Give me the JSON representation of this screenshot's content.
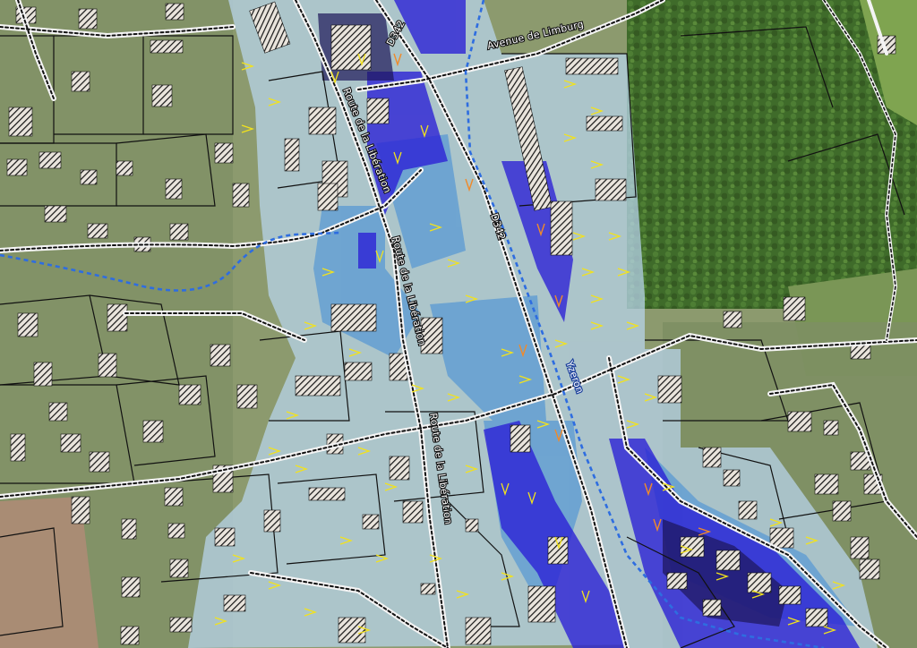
{
  "map": {
    "labels": {
      "avenue_limburg": "Avenue de Limburg",
      "d342_north": "D342",
      "d342_central": "D342",
      "route_liberation_1": "Route de la Libération",
      "route_liberation_2": "Route de la Libération",
      "route_liberation_3": "Route de la Libération",
      "yzeron": "Yzeron"
    },
    "legend_colors": {
      "hazard_low": "#9fc6e6",
      "hazard_medium": "#4f8fd0",
      "hazard_high": "#2a1fd6",
      "hazard_very_high": "#221a6e",
      "flow_arrows": "#f2e21c",
      "flow_arrows_strong": "#f08a2a",
      "river_line": "#2e6de0",
      "parcel_lines": "#111111",
      "roads": "#ffffff"
    }
  }
}
